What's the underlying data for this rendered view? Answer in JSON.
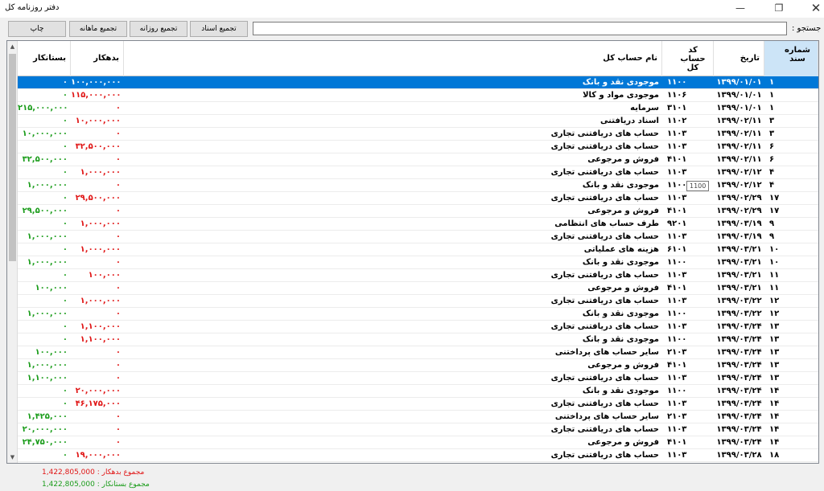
{
  "window": {
    "title": "دفتر روزنامه کل",
    "min": "—",
    "max": "❐",
    "close": "✕"
  },
  "toolbar": {
    "print": "چاپ",
    "monthly": "تجمیع ماهانه",
    "daily": "تجمیع روزانه",
    "docs": "تجمیع اسناد",
    "search_label": "جستجو :",
    "search_value": ""
  },
  "columns": {
    "doc": "شماره سند",
    "date": "تاریخ",
    "code": "کد حساب کل",
    "name": "نام حساب کل",
    "debit": "بدهکار",
    "credit": "بستانکار"
  },
  "rows": [
    {
      "doc": "۱",
      "date": "۱۳۹۹/۰۱/۰۱",
      "code": "۱۱۰۰",
      "name": "موجودی نقد و بانک",
      "debit": "۱۰۰,۰۰۰,۰۰۰",
      "credit": "۰"
    },
    {
      "doc": "۱",
      "date": "۱۳۹۹/۰۱/۰۱",
      "code": "۱۱۰۶",
      "name": "موجودی مواد و کالا",
      "debit": "۱۱۵,۰۰۰,۰۰۰",
      "credit": "۰"
    },
    {
      "doc": "۱",
      "date": "۱۳۹۹/۰۱/۰۱",
      "code": "۳۱۰۱",
      "name": "سرمایه",
      "debit": "۰",
      "credit": "۲۱۵,۰۰۰,۰۰۰"
    },
    {
      "doc": "۳",
      "date": "۱۳۹۹/۰۲/۱۱",
      "code": "۱۱۰۲",
      "name": "اسناد دریافتنی",
      "debit": "۱۰,۰۰۰,۰۰۰",
      "credit": "۰"
    },
    {
      "doc": "۳",
      "date": "۱۳۹۹/۰۲/۱۱",
      "code": "۱۱۰۳",
      "name": "حساب های دریافتنی تجاری",
      "debit": "۰",
      "credit": "۱۰,۰۰۰,۰۰۰"
    },
    {
      "doc": "۶",
      "date": "۱۳۹۹/۰۲/۱۱",
      "code": "۱۱۰۳",
      "name": "حساب های دریافتنی تجاری",
      "debit": "۳۲,۵۰۰,۰۰۰",
      "credit": "۰"
    },
    {
      "doc": "۶",
      "date": "۱۳۹۹/۰۲/۱۱",
      "code": "۴۱۰۱",
      "name": "فروش و مرجوعی",
      "debit": "۰",
      "credit": "۳۲,۵۰۰,۰۰۰"
    },
    {
      "doc": "۴",
      "date": "۱۳۹۹/۰۲/۱۲",
      "code": "۱۱۰۳",
      "name": "حساب های دریافتنی تجاری",
      "debit": "۱,۰۰۰,۰۰۰",
      "credit": "۰"
    },
    {
      "doc": "۴",
      "date": "۱۳۹۹/۰۲/۱۲",
      "code": "۱۱۰۰",
      "name": "موجودی نقد و بانک",
      "debit": "۰",
      "credit": "۱,۰۰۰,۰۰۰"
    },
    {
      "doc": "۱۷",
      "date": "۱۳۹۹/۰۲/۲۹",
      "code": "۱۱۰۳",
      "name": "حساب های دریافتنی تجاری",
      "debit": "۲۹,۵۰۰,۰۰۰",
      "credit": "۰"
    },
    {
      "doc": "۱۷",
      "date": "۱۳۹۹/۰۲/۲۹",
      "code": "۴۱۰۱",
      "name": "فروش و مرجوعی",
      "debit": "۰",
      "credit": "۲۹,۵۰۰,۰۰۰"
    },
    {
      "doc": "۹",
      "date": "۱۳۹۹/۰۳/۱۹",
      "code": "۹۲۰۱",
      "name": "طرف حساب های انتظامی",
      "debit": "۱,۰۰۰,۰۰۰",
      "credit": "۰"
    },
    {
      "doc": "۹",
      "date": "۱۳۹۹/۰۳/۱۹",
      "code": "۱۱۰۳",
      "name": "حساب های دریافتنی تجاری",
      "debit": "۰",
      "credit": "۱,۰۰۰,۰۰۰"
    },
    {
      "doc": "۱۰",
      "date": "۱۳۹۹/۰۳/۲۱",
      "code": "۶۱۰۱",
      "name": "هزینه های عملیاتی",
      "debit": "۱,۰۰۰,۰۰۰",
      "credit": "۰"
    },
    {
      "doc": "۱۰",
      "date": "۱۳۹۹/۰۳/۲۱",
      "code": "۱۱۰۰",
      "name": "موجودی نقد و بانک",
      "debit": "۰",
      "credit": "۱,۰۰۰,۰۰۰"
    },
    {
      "doc": "۱۱",
      "date": "۱۳۹۹/۰۳/۲۱",
      "code": "۱۱۰۳",
      "name": "حساب های دریافتنی تجاری",
      "debit": "۱۰۰,۰۰۰",
      "credit": "۰"
    },
    {
      "doc": "۱۱",
      "date": "۱۳۹۹/۰۳/۲۱",
      "code": "۴۱۰۱",
      "name": "فروش و مرجوعی",
      "debit": "۰",
      "credit": "۱۰۰,۰۰۰"
    },
    {
      "doc": "۱۲",
      "date": "۱۳۹۹/۰۳/۲۲",
      "code": "۱۱۰۳",
      "name": "حساب های دریافتنی تجاری",
      "debit": "۱,۰۰۰,۰۰۰",
      "credit": "۰"
    },
    {
      "doc": "۱۲",
      "date": "۱۳۹۹/۰۳/۲۲",
      "code": "۱۱۰۰",
      "name": "موجودی نقد و بانک",
      "debit": "۰",
      "credit": "۱,۰۰۰,۰۰۰"
    },
    {
      "doc": "۱۳",
      "date": "۱۳۹۹/۰۳/۲۴",
      "code": "۱۱۰۳",
      "name": "حساب های دریافتنی تجاری",
      "debit": "۱,۱۰۰,۰۰۰",
      "credit": "۰"
    },
    {
      "doc": "۱۳",
      "date": "۱۳۹۹/۰۳/۲۴",
      "code": "۱۱۰۰",
      "name": "موجودی نقد و بانک",
      "debit": "۱,۱۰۰,۰۰۰",
      "credit": "۰"
    },
    {
      "doc": "۱۳",
      "date": "۱۳۹۹/۰۳/۲۴",
      "code": "۲۱۰۳",
      "name": "سایر حساب های پرداختنی",
      "debit": "۰",
      "credit": "۱۰۰,۰۰۰"
    },
    {
      "doc": "۱۳",
      "date": "۱۳۹۹/۰۳/۲۴",
      "code": "۴۱۰۱",
      "name": "فروش و مرجوعی",
      "debit": "۰",
      "credit": "۱,۰۰۰,۰۰۰"
    },
    {
      "doc": "۱۳",
      "date": "۱۳۹۹/۰۳/۲۴",
      "code": "۱۱۰۳",
      "name": "حساب های دریافتنی تجاری",
      "debit": "۰",
      "credit": "۱,۱۰۰,۰۰۰"
    },
    {
      "doc": "۱۴",
      "date": "۱۳۹۹/۰۳/۲۴",
      "code": "۱۱۰۰",
      "name": "موجودی نقد و بانک",
      "debit": "۲۰,۰۰۰,۰۰۰",
      "credit": "۰"
    },
    {
      "doc": "۱۴",
      "date": "۱۳۹۹/۰۳/۲۴",
      "code": "۱۱۰۳",
      "name": "حساب های دریافتنی تجاری",
      "debit": "۴۶,۱۷۵,۰۰۰",
      "credit": "۰"
    },
    {
      "doc": "۱۴",
      "date": "۱۳۹۹/۰۳/۲۴",
      "code": "۲۱۰۳",
      "name": "سایر حساب های پرداختنی",
      "debit": "۰",
      "credit": "۱,۴۲۵,۰۰۰"
    },
    {
      "doc": "۱۴",
      "date": "۱۳۹۹/۰۳/۲۴",
      "code": "۱۱۰۳",
      "name": "حساب های دریافتنی تجاری",
      "debit": "۰",
      "credit": "۲۰,۰۰۰,۰۰۰"
    },
    {
      "doc": "۱۴",
      "date": "۱۳۹۹/۰۳/۲۴",
      "code": "۴۱۰۱",
      "name": "فروش و مرجوعی",
      "debit": "۰",
      "credit": "۲۴,۷۵۰,۰۰۰"
    },
    {
      "doc": "۱۸",
      "date": "۱۳۹۹/۰۳/۲۸",
      "code": "۱۱۰۳",
      "name": "حساب های دریافتنی تجاری",
      "debit": "۱۹,۰۰۰,۰۰۰",
      "credit": "۰"
    }
  ],
  "tooltip": "1100",
  "totals": {
    "debit_label": "مجموع بدهکار :",
    "debit_value": "1,422,805,000",
    "credit_label": "مجموع بستانکار :",
    "credit_value": "1,422,805,000"
  },
  "colors": {
    "selection": "#0078d7",
    "debit": "#e01515",
    "credit": "#1a9c1a"
  }
}
